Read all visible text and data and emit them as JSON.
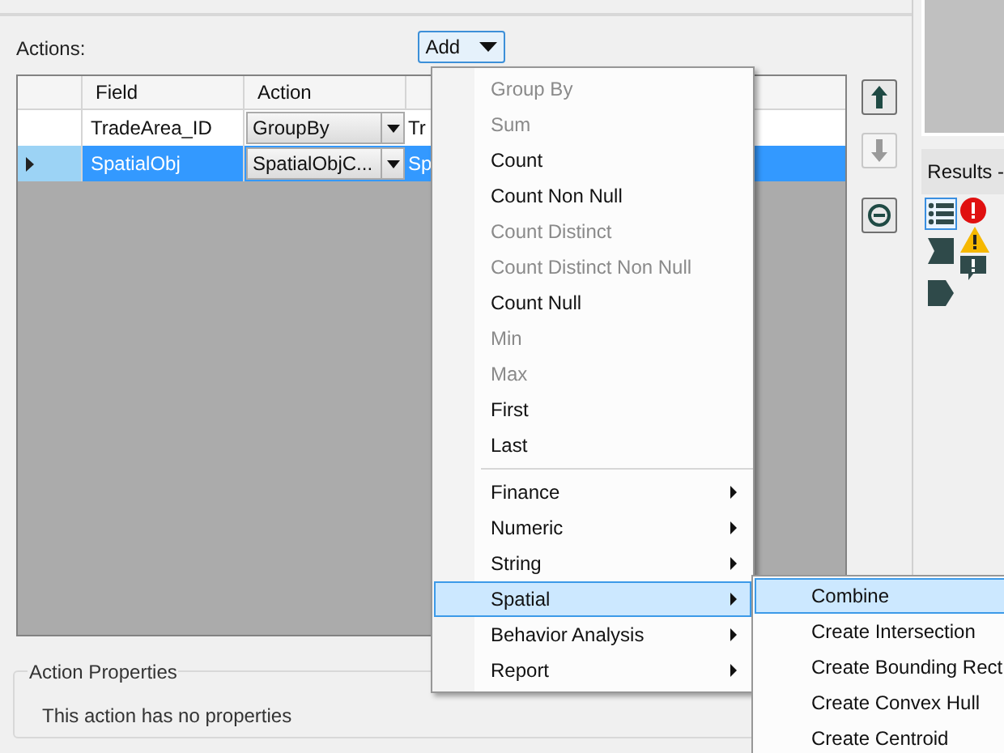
{
  "actions_label": "Actions:",
  "add_button": {
    "label": "Add"
  },
  "grid": {
    "columns": [
      "Field",
      "Action"
    ],
    "rows": [
      {
        "selected": false,
        "field": "TradeArea_ID",
        "action": "GroupBy",
        "column_3": "Tr"
      },
      {
        "selected": true,
        "field": "SpatialObj",
        "action": "SpatialObjC...",
        "column_3": "Sp"
      }
    ]
  },
  "side_buttons": [
    {
      "kind": "up",
      "disabled": false
    },
    {
      "kind": "down",
      "disabled": true
    },
    {
      "kind": "remove",
      "disabled": false
    }
  ],
  "menu": [
    {
      "kind": "item",
      "label": "Group By",
      "disabled": true,
      "selected": false
    },
    {
      "kind": "item",
      "label": "Sum",
      "disabled": true,
      "selected": false
    },
    {
      "kind": "item",
      "label": "Count",
      "disabled": false,
      "selected": false
    },
    {
      "kind": "item",
      "label": "Count Non Null",
      "disabled": false,
      "selected": false
    },
    {
      "kind": "item",
      "label": "Count Distinct",
      "disabled": true,
      "selected": false
    },
    {
      "kind": "item",
      "label": "Count Distinct Non Null",
      "disabled": true,
      "selected": false
    },
    {
      "kind": "item",
      "label": "Count Null",
      "disabled": false,
      "selected": false
    },
    {
      "kind": "item",
      "label": "Min",
      "disabled": true,
      "selected": false
    },
    {
      "kind": "item",
      "label": "Max",
      "disabled": true,
      "selected": false
    },
    {
      "kind": "item",
      "label": "First",
      "disabled": false,
      "selected": false
    },
    {
      "kind": "item",
      "label": "Last",
      "disabled": false,
      "selected": false
    },
    {
      "kind": "separator"
    },
    {
      "kind": "submenu",
      "label": "Finance",
      "disabled": false,
      "selected": false
    },
    {
      "kind": "submenu",
      "label": "Numeric",
      "disabled": false,
      "selected": false
    },
    {
      "kind": "submenu",
      "label": "String",
      "disabled": false,
      "selected": false
    },
    {
      "kind": "submenu",
      "label": "Spatial",
      "disabled": false,
      "selected": true
    },
    {
      "kind": "submenu",
      "label": "Behavior Analysis",
      "disabled": false,
      "selected": false
    },
    {
      "kind": "submenu",
      "label": "Report",
      "disabled": false,
      "selected": false
    }
  ],
  "submenu": [
    {
      "label": "Combine",
      "selected": true
    },
    {
      "label": "Create Intersection",
      "selected": false
    },
    {
      "label": "Create Bounding Rect",
      "selected": false
    },
    {
      "label": "Create Convex Hull",
      "selected": false
    },
    {
      "label": "Create Centroid",
      "selected": false
    }
  ],
  "action_properties": {
    "title": "Action Properties",
    "text": "This action has no properties"
  },
  "results": {
    "title": "Results -"
  }
}
